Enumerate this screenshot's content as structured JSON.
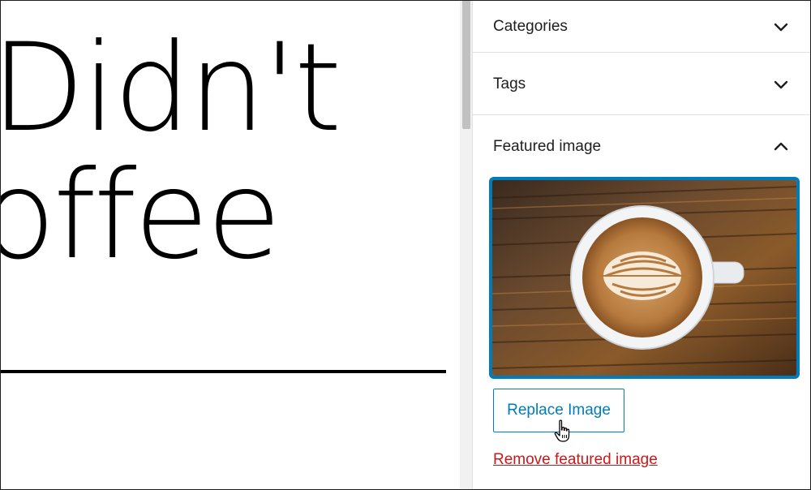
{
  "editor": {
    "title_line1": "Didn't",
    "title_line2": "offee"
  },
  "sidebar": {
    "panels": [
      {
        "label": "Categories",
        "state": "collapsed",
        "icon": "chevron-down-icon"
      },
      {
        "label": "Tags",
        "state": "collapsed",
        "icon": "chevron-down-icon"
      },
      {
        "label": "Featured image",
        "state": "expanded",
        "icon": "chevron-up-icon"
      }
    ],
    "featured_image": {
      "image_icon": "coffee-latte-image",
      "replace_label": "Replace Image",
      "remove_label": "Remove featured image"
    }
  },
  "colors": {
    "accent": "#007cba",
    "destructive": "#cc1818",
    "text": "#1e1e1e"
  }
}
